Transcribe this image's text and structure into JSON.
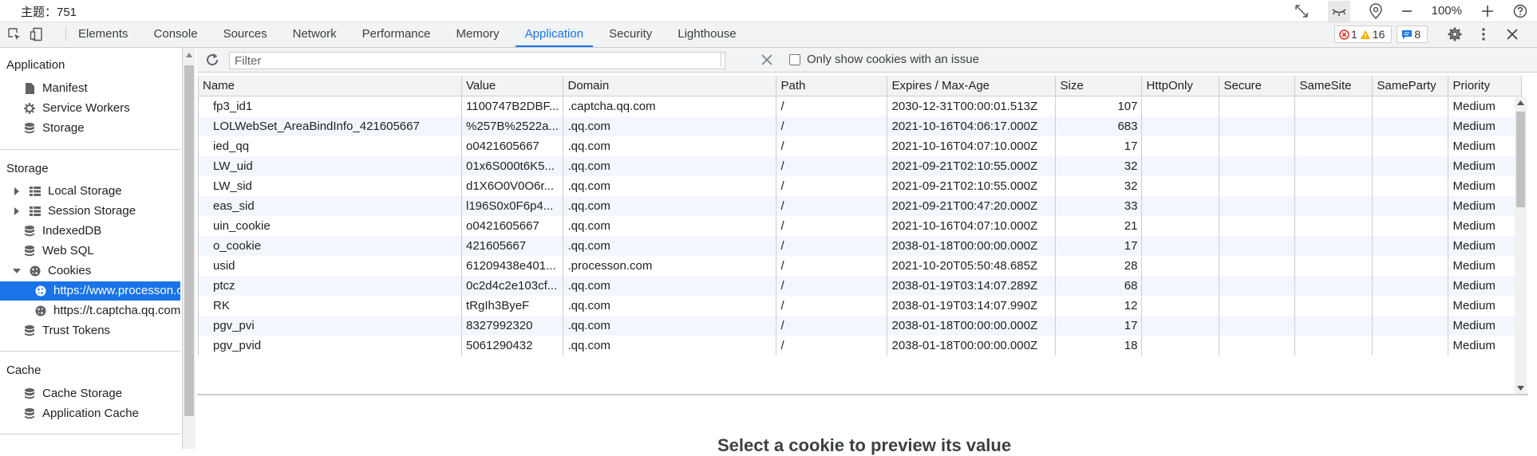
{
  "window": {
    "title": "主题：751"
  },
  "zoom": {
    "value": "100%"
  },
  "tabs": [
    {
      "label": "Elements"
    },
    {
      "label": "Console"
    },
    {
      "label": "Sources"
    },
    {
      "label": "Network"
    },
    {
      "label": "Performance"
    },
    {
      "label": "Memory"
    },
    {
      "label": "Application"
    },
    {
      "label": "Security"
    },
    {
      "label": "Lighthouse"
    }
  ],
  "badges": {
    "errors": "1",
    "warnings": "16",
    "messages": "8"
  },
  "sidebar": {
    "application_header": "Application",
    "app_items": [
      {
        "label": "Manifest",
        "icon": "file-icon"
      },
      {
        "label": "Service Workers",
        "icon": "gear-icon"
      },
      {
        "label": "Storage",
        "icon": "database-icon"
      }
    ],
    "storage_header": "Storage",
    "storage_items": [
      {
        "label": "Local Storage",
        "icon": "grid-icon"
      },
      {
        "label": "Session Storage",
        "icon": "grid-icon"
      },
      {
        "label": "IndexedDB",
        "icon": "database-icon"
      },
      {
        "label": "Web SQL",
        "icon": "database-icon"
      },
      {
        "label": "Cookies",
        "icon": "cookie-icon"
      },
      {
        "label": "https://www.processon.com",
        "icon": "cookie-icon"
      },
      {
        "label": "https://t.captcha.qq.com",
        "icon": "cookie-icon"
      },
      {
        "label": "Trust Tokens",
        "icon": "database-icon"
      }
    ],
    "cache_header": "Cache",
    "cache_items": [
      {
        "label": "Cache Storage",
        "icon": "database-icon"
      },
      {
        "label": "Application Cache",
        "icon": "database-icon"
      }
    ]
  },
  "toolbar": {
    "filter_placeholder": "Filter",
    "only_issue_label": "Only show cookies with an issue"
  },
  "table": {
    "headers": [
      "Name",
      "Value",
      "Domain",
      "Path",
      "Expires / Max-Age",
      "Size",
      "HttpOnly",
      "Secure",
      "SameSite",
      "SameParty",
      "Priority"
    ],
    "rows": [
      [
        "fp3_id1",
        "1100747B2DBF...",
        ".captcha.qq.com",
        "/",
        "2030-12-31T00:00:01.513Z",
        "107",
        "",
        "",
        "",
        "",
        "Medium"
      ],
      [
        "LOLWebSet_AreaBindInfo_421605667",
        "%257B%2522a...",
        ".qq.com",
        "/",
        "2021-10-16T04:06:17.000Z",
        "683",
        "",
        "",
        "",
        "",
        "Medium"
      ],
      [
        "ied_qq",
        "o0421605667",
        ".qq.com",
        "/",
        "2021-10-16T04:07:10.000Z",
        "17",
        "",
        "",
        "",
        "",
        "Medium"
      ],
      [
        "LW_uid",
        "01x6S000t6K5...",
        ".qq.com",
        "/",
        "2021-09-21T02:10:55.000Z",
        "32",
        "",
        "",
        "",
        "",
        "Medium"
      ],
      [
        "LW_sid",
        "d1X6O0V0O6r...",
        ".qq.com",
        "/",
        "2021-09-21T02:10:55.000Z",
        "32",
        "",
        "",
        "",
        "",
        "Medium"
      ],
      [
        "eas_sid",
        "l196S0x0F6p4...",
        ".qq.com",
        "/",
        "2021-09-21T00:47:20.000Z",
        "33",
        "",
        "",
        "",
        "",
        "Medium"
      ],
      [
        "uin_cookie",
        "o0421605667",
        ".qq.com",
        "/",
        "2021-10-16T04:07:10.000Z",
        "21",
        "",
        "",
        "",
        "",
        "Medium"
      ],
      [
        "o_cookie",
        "421605667",
        ".qq.com",
        "/",
        "2038-01-18T00:00:00.000Z",
        "17",
        "",
        "",
        "",
        "",
        "Medium"
      ],
      [
        "usid",
        "61209438e401...",
        ".processon.com",
        "/",
        "2021-10-20T05:50:48.685Z",
        "28",
        "",
        "",
        "",
        "",
        "Medium"
      ],
      [
        "ptcz",
        "0c2d4c2e103cf...",
        ".qq.com",
        "/",
        "2038-01-19T03:14:07.289Z",
        "68",
        "",
        "",
        "",
        "",
        "Medium"
      ],
      [
        "RK",
        "tRgIh3ByeF",
        ".qq.com",
        "/",
        "2038-01-19T03:14:07.990Z",
        "12",
        "",
        "",
        "",
        "",
        "Medium"
      ],
      [
        "pgv_pvi",
        "8327992320",
        ".qq.com",
        "/",
        "2038-01-18T00:00:00.000Z",
        "17",
        "",
        "",
        "",
        "",
        "Medium"
      ],
      [
        "pgv_pvid",
        "5061290432",
        ".qq.com",
        "/",
        "2038-01-18T00:00:00.000Z",
        "18",
        "",
        "",
        "",
        "",
        "Medium"
      ]
    ]
  },
  "preview": {
    "message": "Select a cookie to preview its value"
  }
}
